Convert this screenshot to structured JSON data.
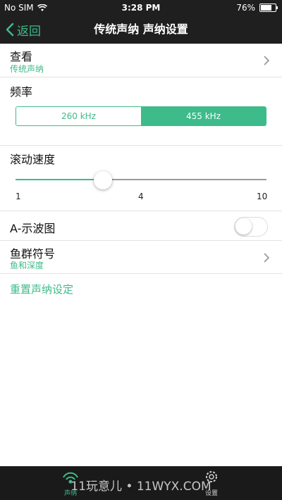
{
  "status": {
    "carrier": "No SIM",
    "time": "3:28 PM",
    "battery": "76%",
    "battery_level": 0.76
  },
  "nav": {
    "back_label": "返回",
    "title": "传统声纳 声纳设置"
  },
  "view_row": {
    "title": "查看",
    "value": "传统声纳"
  },
  "frequency": {
    "label": "频率",
    "options": [
      "260 kHz",
      "455 kHz"
    ],
    "selected": "455 kHz"
  },
  "scroll_speed": {
    "label": "滚动速度",
    "min_label": "1",
    "mid_label": "4",
    "max_label": "10",
    "value": 3
  },
  "a_scope": {
    "label": "A-示波图",
    "enabled": false
  },
  "fish_symbol": {
    "title": "鱼群符号",
    "value": "鱼和深度"
  },
  "reset_label": "重置声纳设定",
  "tabs": [
    {
      "label": "声纳",
      "icon": "sonar-icon",
      "active": true
    },
    {
      "label": "设置",
      "icon": "gear-icon",
      "active": false
    }
  ],
  "watermark": "11玩意儿 • 11WYX.COM",
  "colors": {
    "accent": "#3dbb8a",
    "bar": "#1f1f1f"
  }
}
